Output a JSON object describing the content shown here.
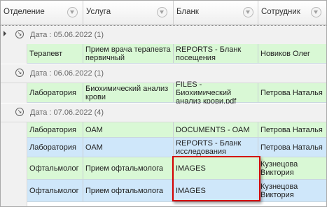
{
  "columns": [
    {
      "label": "Отделение"
    },
    {
      "label": "Услуга"
    },
    {
      "label": "Бланк"
    },
    {
      "label": "Сотрудник"
    }
  ],
  "groups": [
    {
      "label": "Дата : 05.06.2022 (1)",
      "rows": [
        [
          "Терапевт",
          "Прием врача терапевта первичный",
          "REPORTS - Бланк посещения",
          "Новиков Олег"
        ]
      ]
    },
    {
      "label": "Дата : 06.06.2022 (1)",
      "rows": [
        [
          "Лаборатория",
          "Биохимический анализ крови",
          "FILES - Биохимический анализ крови.pdf",
          "Петрова Наталья"
        ]
      ]
    },
    {
      "label": "Дата : 07.06.2022 (4)",
      "rows": [
        [
          "Лаборатория",
          "ОАМ",
          "DOCUMENTS - ОАМ",
          "Петрова Наталья"
        ],
        [
          "Лаборатория",
          "ОАМ",
          "REPORTS - Бланк исследования",
          "Петрова Наталья"
        ],
        [
          "Офтальмолог",
          "Прием офтальмолога",
          "IMAGES",
          "Кузнецова Виктория"
        ],
        [
          "Офтальмолог",
          "Прием офтальмолога",
          "IMAGES",
          "Кузнецова Виктория"
        ]
      ]
    }
  ],
  "colors": {
    "row_green": "#d9f8d5",
    "row_blue": "#cfe7fa",
    "highlight": "#d40000"
  }
}
